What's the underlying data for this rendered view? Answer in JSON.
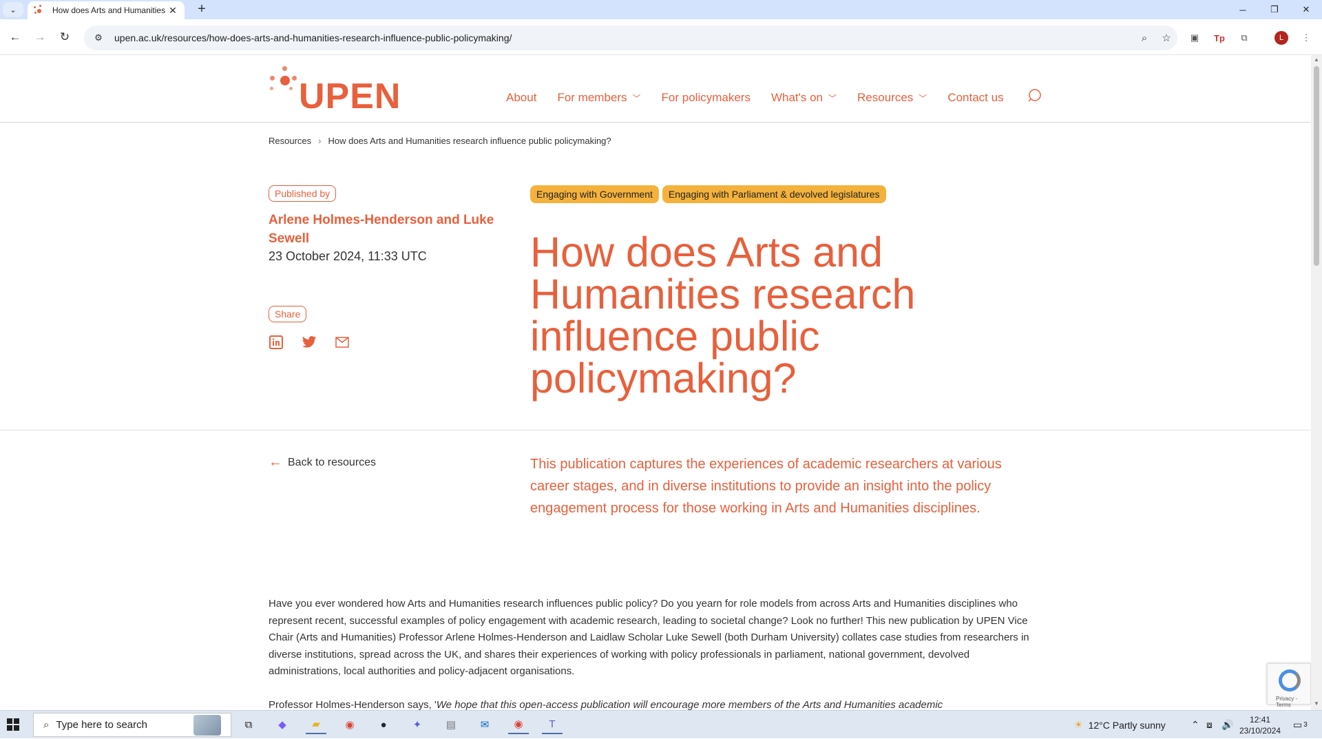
{
  "browser": {
    "tab_title": "How does Arts and Humanities",
    "tab_close": "✕",
    "new_tab": "+",
    "url": "upen.ac.uk/resources/how-does-arts-and-humanities-research-influence-public-policymaking/"
  },
  "site": {
    "logo_text": "UPEN",
    "nav": [
      {
        "label": "About",
        "has_dropdown": false
      },
      {
        "label": "For members",
        "has_dropdown": true
      },
      {
        "label": "For policymakers",
        "has_dropdown": false
      },
      {
        "label": "What's on",
        "has_dropdown": true
      },
      {
        "label": "Resources",
        "has_dropdown": true
      },
      {
        "label": "Contact us",
        "has_dropdown": false
      }
    ],
    "accent_color": "#e8603c",
    "tag_color": "#f4b23c"
  },
  "breadcrumb": {
    "root": "Resources",
    "separator": "›",
    "current": "How does Arts and Humanities research influence public policymaking?"
  },
  "article": {
    "published_by_label": "Published by",
    "authors": "Arlene Holmes-Henderson and Luke Sewell",
    "date": "23 October 2024, 11:33 UTC",
    "share_label": "Share",
    "share_icons": [
      "linkedin-icon",
      "twitter-icon",
      "email-icon"
    ],
    "tags": [
      "Engaging with Government",
      "Engaging with Parliament & devolved legislatures"
    ],
    "title": "How does Arts and Humanities research influence public policymaking?",
    "back_label": "Back to resources",
    "lead": "This publication captures the experiences of academic researchers at various career stages, and in diverse institutions to provide an insight into the policy engagement process for those working in Arts and Humanities disciplines.",
    "body_1": "Have you ever wondered how Arts and Humanities research influences public policy? Do you yearn for role models from across Arts and Humanities disciplines who represent recent, successful examples of policy engagement with academic research, leading to societal change? Look no further! This new publication by UPEN Vice Chair (Arts and Humanities) Professor Arlene Holmes-Henderson and Laidlaw Scholar Luke Sewell (both Durham University) collates case studies from researchers in diverse institutions, spread across the UK, and shares their experiences of working with policy professionals in parliament, national government, devolved administrations, local authorities and policy-adjacent organisations.",
    "body_2_start": "Professor Holmes-Henderson says, '",
    "body_2_italic": "We hope that this open-access publication will encourage more members of the Arts and Humanities academic"
  },
  "recaptcha": {
    "text": "Privacy - Terms"
  },
  "taskbar": {
    "search_placeholder": "Type here to search",
    "weather": "12°C  Partly sunny",
    "time": "12:41",
    "date": "23/10/2024",
    "notification_count": "3"
  }
}
